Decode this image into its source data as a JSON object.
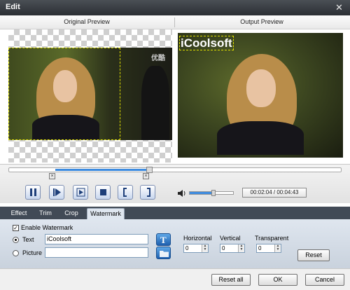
{
  "window": {
    "title": "Edit",
    "close_symbol": "✕"
  },
  "preview": {
    "original_label": "Original Preview",
    "output_label": "Output Preview",
    "source_watermark": "优酷",
    "output_watermark_text": "iCoolsoft"
  },
  "playback": {
    "time_display": "00:02:04 / 00:04:43",
    "volume_level": 0.55,
    "trim_start_marker": "×",
    "trim_end_marker": "×"
  },
  "tabs": [
    {
      "label": "Effect",
      "active": false
    },
    {
      "label": "Trim",
      "active": false
    },
    {
      "label": "Crop",
      "active": false
    },
    {
      "label": "Watermark",
      "active": true
    }
  ],
  "watermark": {
    "enable_label": "Enable Watermark",
    "enable_checked": true,
    "text_label": "Text",
    "text_value": "iCoolsoft",
    "picture_label": "Picture",
    "picture_value": "",
    "horizontal_label": "Horizontal",
    "horizontal_value": "0",
    "vertical_label": "Vertical",
    "vertical_value": "0",
    "transparent_label": "Transparent",
    "transparent_value": "0",
    "reset_label": "Reset"
  },
  "footer": {
    "reset_all_label": "Reset all",
    "ok_label": "OK",
    "cancel_label": "Cancel"
  }
}
